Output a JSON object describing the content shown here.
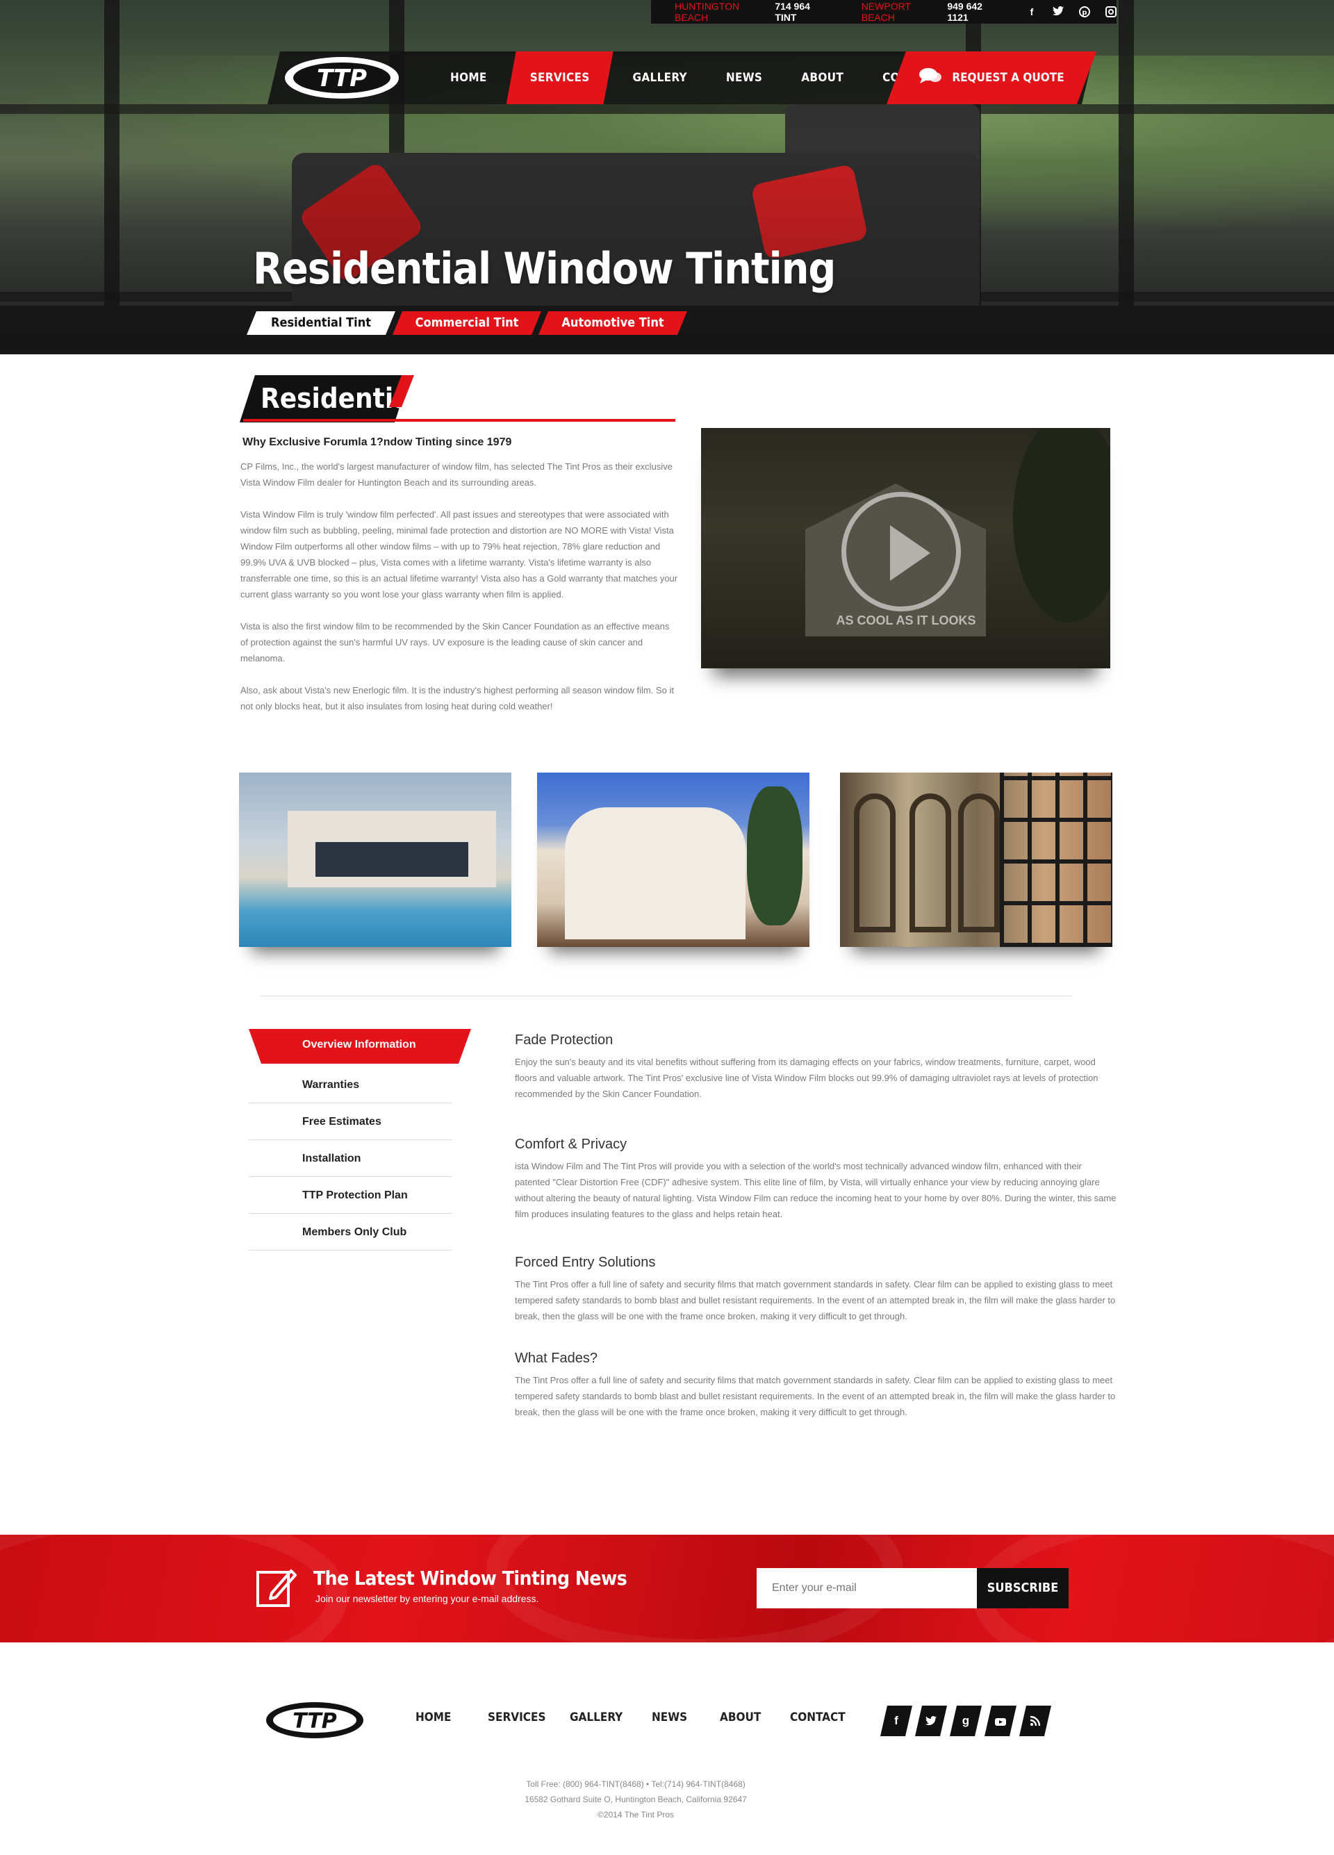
{
  "topbar": {
    "loc1_label": "HUNTINGTON BEACH",
    "loc1_phone": "714 964 TINT",
    "loc2_label": "NEWPORT BEACH",
    "loc2_phone": "949 642 1121",
    "social": [
      "facebook-icon",
      "twitter-icon",
      "pinterest-icon",
      "instagram-icon"
    ]
  },
  "nav": {
    "items": [
      "HOME",
      "SERVICES",
      "GALLERY",
      "NEWS",
      "ABOUT",
      "CONTACT"
    ],
    "active": "SERVICES",
    "quote": "REQUEST A QUOTE"
  },
  "hero": {
    "title": "Residential Window Tinting",
    "tabs": [
      "Residential Tint",
      "Commercial Tint",
      "Automotive Tint"
    ]
  },
  "residential": {
    "title": "Residential",
    "subtitle": "Why Exclusive Forumla 1?ndow Tinting since 1979",
    "paragraphs": [
      "CP Films, Inc., the world's largest manufacturer of window film, has selected The Tint Pros as their exclusive Vista Window Film dealer for Huntington Beach and its surrounding areas.",
      "Vista Window Film is truly 'window film perfected'. All past issues and stereotypes that were associated with window film such as bubbling, peeling, minimal fade protection and distortion are NO MORE with Vista! Vista Window Film outperforms all other window films – with up to 79% heat rejection, 78% glare reduction and 99.9% UVA & UVB blocked – plus, Vista comes with a lifetime warranty. Vista's lifetime warranty is also transferrable one time, so this is an actual lifetime warranty! Vista also has a Gold warranty that matches your current glass warranty so you wont lose your glass warranty when film is applied.",
      "Vista is also the first window film to be recommended by the Skin Cancer Foundation as an effective means of protection against the sun's harmful UV rays. UV exposure is the leading cause of skin cancer and melanoma.",
      "Also, ask about Vista's new Enerlogic film. It is the industry's highest performing all season window film. So it not only blocks heat, but it also insulates from losing heat during cold weather!"
    ],
    "video_caption": "AS COOL AS IT LOOKS"
  },
  "menu": [
    "Overview Information",
    "Warranties",
    "Free Estimates",
    "Installation",
    "TTP Protection Plan",
    "Members Only Club"
  ],
  "features": [
    {
      "title": "Fade Protection",
      "text": "Enjoy the sun's beauty and its vital benefits without suffering from its damaging effects on your fabrics, window treatments, furniture, carpet, wood floors and valuable artwork. The Tint Pros' exclusive line of Vista Window Film blocks out 99.9% of damaging ultraviolet rays at levels of protection recommended by the Skin Cancer Foundation."
    },
    {
      "title": "Comfort & Privacy",
      "text": "ista Window Film and The Tint Pros will provide you with a selection of the world's most technically advanced window film, enhanced with their patented \"Clear Distortion Free (CDF)\" adhesive system. This elite line of film, by Vista, will virtually enhance your view by reducing annoying glare without altering the beauty of natural lighting. Vista Window Film can reduce the incoming heat to your home by over 80%. During the winter, this same film produces insulating features to the glass and helps retain heat."
    },
    {
      "title": "Forced Entry Solutions",
      "text": "The Tint Pros offer a full line of safety and security films that match government standards in safety. Clear film can be applied to existing glass to meet tempered safety standards to bomb blast and bullet resistant requirements. In the event of an attempted break in, the film will make the glass harder to break, then the glass will be one with the frame once broken, making it very difficult to get through."
    },
    {
      "title": "What Fades?",
      "text": "The Tint Pros offer a full line of safety and security films that match government standards in safety. Clear film can be applied to existing glass to meet tempered safety standards to bomb blast and bullet resistant requirements. In the event of an attempted break in, the film will make the glass harder to break, then the glass will be one with the frame once broken, making it very difficult to get through."
    }
  ],
  "newsletter": {
    "title": "The Latest Window Tinting News",
    "subtitle": "Join our newsletter by entering your e-mail address.",
    "placeholder": "Enter your e-mail",
    "button": "SUBSCRIBE"
  },
  "footer": {
    "nav": [
      "HOME",
      "SERVICES",
      "GALLERY",
      "NEWS",
      "ABOUT",
      "CONTACT"
    ],
    "social": [
      "facebook-icon",
      "twitter-icon",
      "google-plus-icon",
      "youtube-icon",
      "rss-icon"
    ],
    "line1": "Toll Free: (800) 964-TINT(8468) • Tel:(714) 964-TINT(8468)",
    "line2": "16582 Gothard Suite O, Huntington Beach, California 92647",
    "line3": "©2014 The Tint Pros"
  },
  "colors": {
    "accent": "#e3131a",
    "dark": "#111111"
  }
}
